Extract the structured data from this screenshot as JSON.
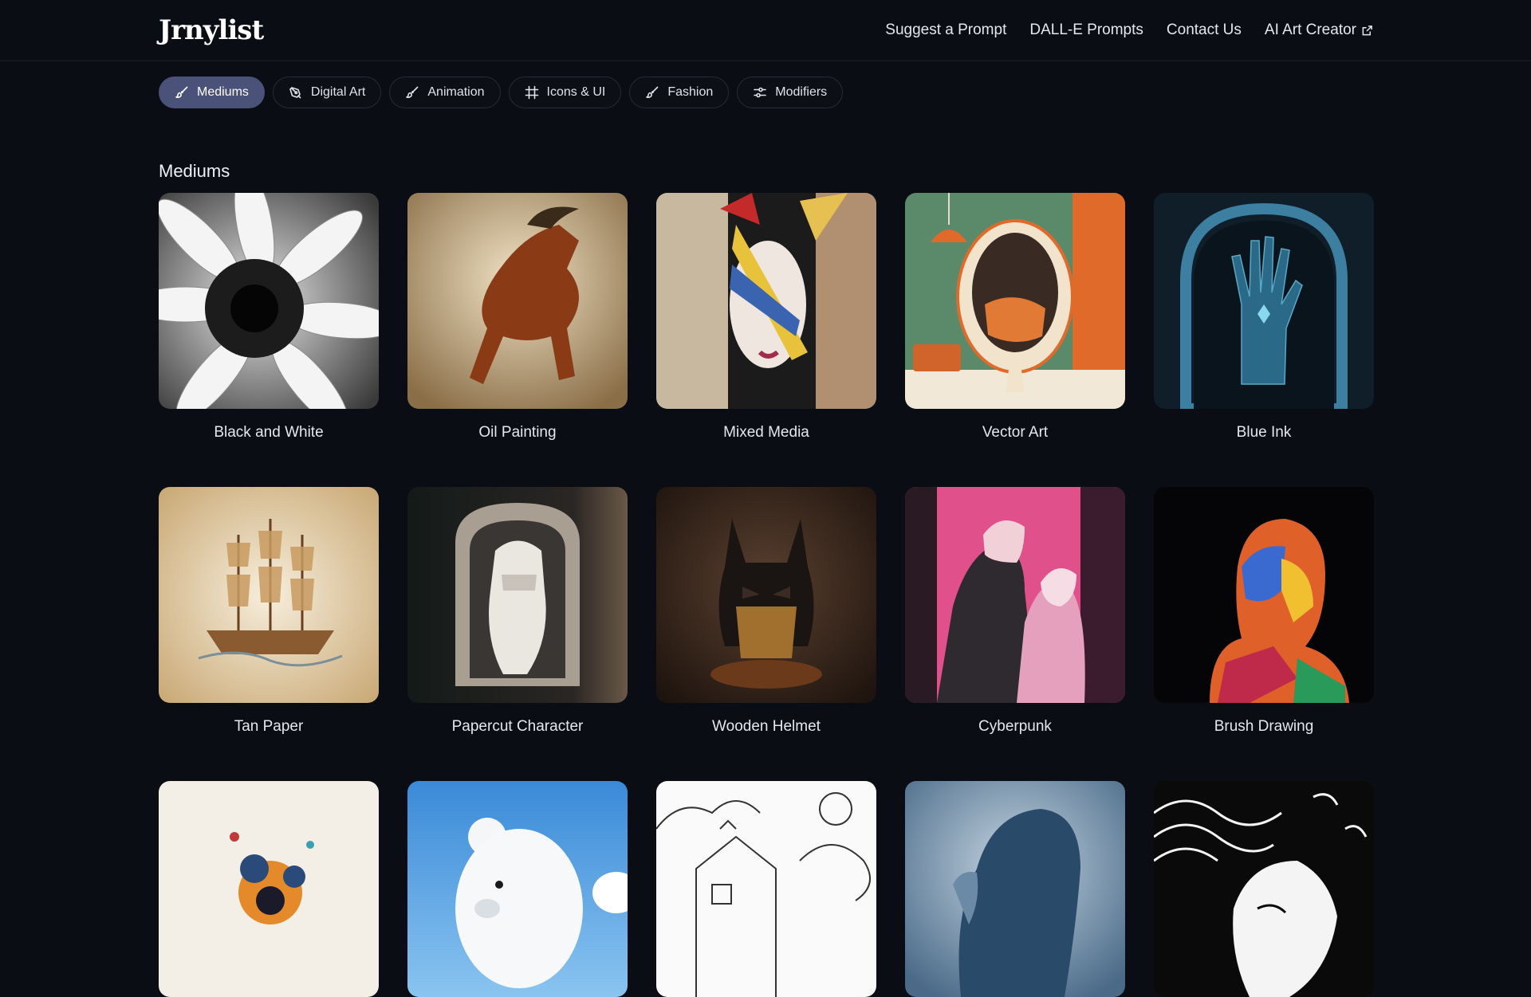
{
  "header": {
    "logo": "Jrnylist",
    "nav": [
      {
        "label": "Suggest a Prompt"
      },
      {
        "label": "DALL-E Prompts"
      },
      {
        "label": "Contact Us"
      },
      {
        "label": "AI Art Creator",
        "icon": "external-link-icon"
      }
    ]
  },
  "categories": [
    {
      "label": "Mediums",
      "icon": "brush-icon",
      "active": true
    },
    {
      "label": "Digital Art",
      "icon": "pen-tool-icon",
      "active": false
    },
    {
      "label": "Animation",
      "icon": "brush-icon",
      "active": false
    },
    {
      "label": "Icons & UI",
      "icon": "hash-frame-icon",
      "active": false
    },
    {
      "label": "Fashion",
      "icon": "brush-icon",
      "active": false
    },
    {
      "label": "Modifiers",
      "icon": "sliders-icon",
      "active": false
    }
  ],
  "section": {
    "title": "Mediums"
  },
  "cards": [
    {
      "label": "Black and White"
    },
    {
      "label": "Oil Painting"
    },
    {
      "label": "Mixed Media"
    },
    {
      "label": "Vector Art"
    },
    {
      "label": "Blue Ink"
    },
    {
      "label": "Tan Paper"
    },
    {
      "label": "Papercut Character"
    },
    {
      "label": "Wooden Helmet"
    },
    {
      "label": "Cyberpunk"
    },
    {
      "label": "Brush Drawing"
    }
  ],
  "colors": {
    "background": "#0b0d14",
    "active_chip": "#4b5279",
    "text": "#e6e7ec"
  }
}
